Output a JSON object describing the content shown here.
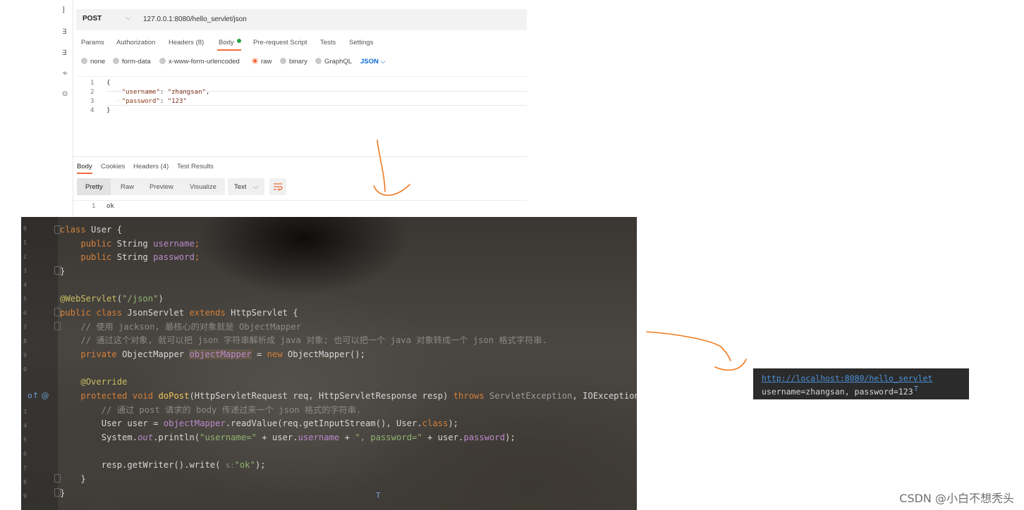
{
  "request": {
    "method": "POST",
    "url": "127.0.0.1:8080/hello_servlet/json",
    "tabs": {
      "params": "Params",
      "authorization": "Authorization",
      "headers": "Headers",
      "headers_count": "(8)",
      "body": "Body",
      "prerequest": "Pre-request Script",
      "tests": "Tests",
      "settings": "Settings"
    },
    "body_types": {
      "none": "none",
      "form_data": "form-data",
      "urlencoded": "x-www-form-urlencoded",
      "raw": "raw",
      "binary": "binary",
      "graphql": "GraphQL",
      "format": "JSON"
    },
    "editor": {
      "line_numbers": [
        "1",
        "2",
        "3",
        "4"
      ],
      "open_brace": "{",
      "username_key": "\"username\"",
      "username_value": "\"zhangsan\"",
      "password_key": "\"password\"",
      "password_value": "\"123\"",
      "close_brace": "}"
    }
  },
  "response": {
    "tabs": {
      "body": "Body",
      "cookies": "Cookies",
      "headers": "Headers",
      "headers_count": "(4)",
      "test_results": "Test Results"
    },
    "views": {
      "pretty": "Pretty",
      "raw": "Raw",
      "preview": "Preview",
      "visualize": "Visualize"
    },
    "format": "Text",
    "line_number": "1",
    "body_text": "ok"
  },
  "code": {
    "l1_kw": "class",
    "l1_name": " User {",
    "l2_kw": "public",
    "l2_type": " String ",
    "l2_field": "username",
    "l3_kw": "public",
    "l3_type": " String ",
    "l3_field": "password",
    "l4": "}",
    "l6_ann": "@WebServlet",
    "l6_arg": "\"/json\"",
    "l7_kw1": "public class",
    "l7_name": " JsonServlet ",
    "l7_kw2": "extends",
    "l7_super": " HttpServlet {",
    "l8_comment": "// 使用 jackson, 最核心的对象就是 ObjectMapper",
    "l9_comment": "// 通过这个对象, 就可以把 json 字符串解析成 java 对象; 也可以把一个 java 对象转成一个 json 格式字符串.",
    "l10_kw": "private",
    "l10_type": " ObjectMapper ",
    "l10_field": "objectMapper",
    "l10_eq": " = ",
    "l10_new": "new",
    "l10_ctor": " ObjectMapper();",
    "l12_ann": "@Override",
    "l13_kw": "protected void",
    "l13_fn": "doPost",
    "l13_params": "(HttpServletRequest req, HttpServletResponse resp) ",
    "l13_throws": "throws",
    "l13_exc1": " ServletException",
    "l13_exc2": ", IOException {",
    "l14_comment": "// 通过 post 请求的 body 传递过来一个 json 格式的字符串.",
    "l15_a": "User user = ",
    "l15_field": "objectMapper",
    "l15_b": ".readValue(req.getInputStream(), User.",
    "l15_kw": "class",
    "l15_c": ");",
    "l16_a": "System.",
    "l16_out": "out",
    "l16_b": ".println(",
    "l16_s1": "\"username=\"",
    "l16_c": " + user.",
    "l16_f1": "username",
    "l16_d": " + ",
    "l16_s2": "\", password=\"",
    "l16_e": " + user.",
    "l16_f2": "password",
    "l16_f": ");",
    "l18_a": "resp.getWriter().write(",
    "l18_hint": "s:",
    "l18_s": "\"ok\"",
    "l18_b": ");",
    "l19": "}",
    "l20": "}",
    "gutter_icons": "o↑ @"
  },
  "console": {
    "link": "http://localhost:8080/hello_servlet",
    "output": "username=zhangsan, password=123"
  },
  "watermark": "CSDN @小白不想秃头",
  "colors": {
    "accent_orange": "#f26b3a",
    "annotation_orange": "#f07a1f",
    "link_blue": "#4a8fd6"
  }
}
